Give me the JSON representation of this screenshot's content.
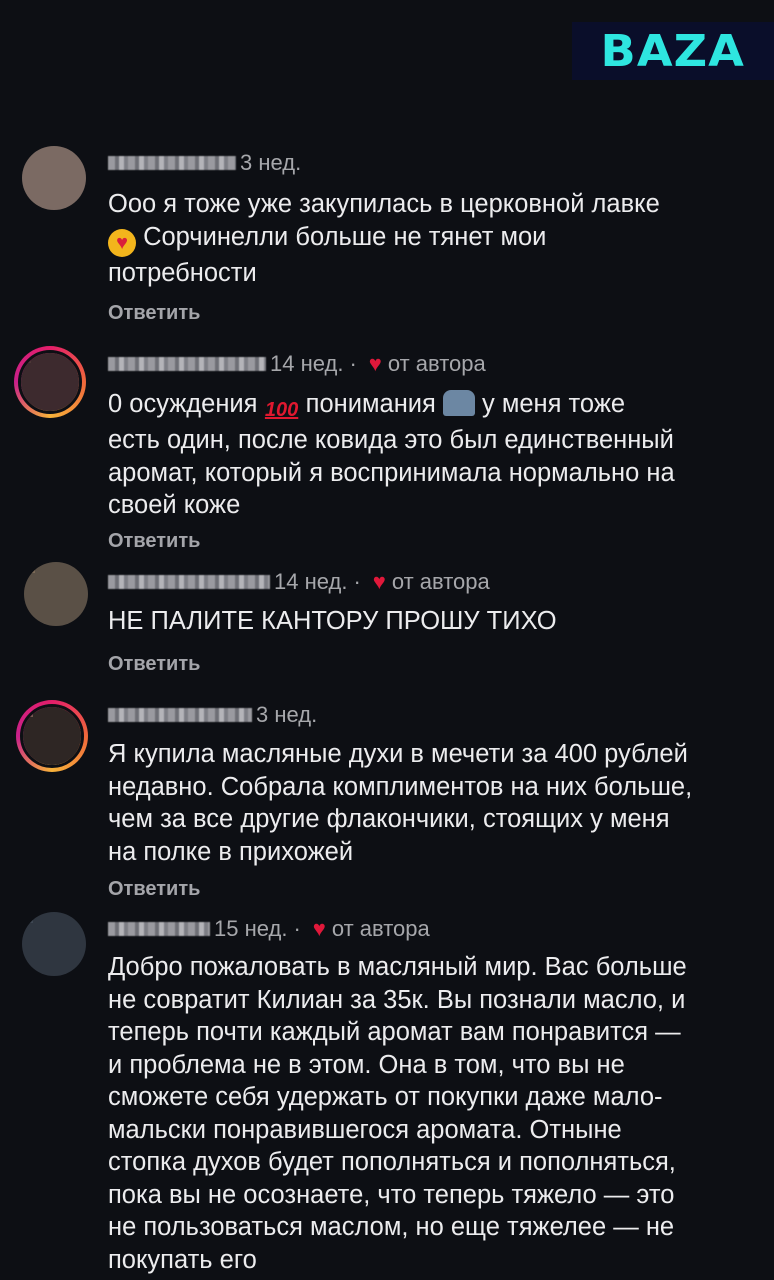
{
  "logo": {
    "text": "BAZA",
    "color": "#2ee6e0",
    "background": "#0a0e2a"
  },
  "reply_label": "Ответить",
  "comments": [
    {
      "time": "3 нед.",
      "author_badge": false,
      "lines": [
        "Ооо я тоже уже закупилась в церковной лавке",
        " Сорчинелли больше не тянет мои",
        "потребности"
      ],
      "emoji": "heart-eyes-icon"
    },
    {
      "time": "14 нед.",
      "author_badge": true,
      "author_text": "от автора",
      "lines": [
        "0 осуждения ",
        " понимания ",
        " у меня тоже",
        "есть один, после ковида это был единственный",
        "аромат, который я воспринимала нормально на",
        "своей коже"
      ]
    },
    {
      "time": "14 нед.",
      "author_badge": true,
      "author_text": "от автора",
      "lines": [
        "НЕ ПАЛИТЕ КАНТОРУ ПРОШУ ТИХО"
      ]
    },
    {
      "time": "3 нед.",
      "author_badge": false,
      "lines": [
        "Я купила масляные духи в мечети за 400 рублей",
        "недавно. Собрала комплиментов на них больше,",
        "чем за все другие флакончики, стоящих у меня",
        "на полке в прихожей"
      ]
    },
    {
      "time": "15 нед.",
      "author_badge": true,
      "author_text": "от автора",
      "lines": [
        "Добро пожаловать в масляный мир. Вас больше",
        "не совратит Килиан за 35к. Вы познали масло, и",
        "теперь почти каждый аромат вам понравится —",
        "и проблема не в этом. Она в том, что вы не",
        "сможете себя удержать от покупки даже мало-",
        "мальски понравившегося аромата. Отныне",
        "стопка духов будет пополняться и пополняться,",
        "пока вы не осознаете, что теперь тяжело — это",
        "не пользоваться маслом, но еще тяжелее — не",
        "покупать его"
      ]
    }
  ],
  "emoji_icons": {
    "hundred": "100-icon",
    "people": "people-icon",
    "heart_eyes": "heart-eyes-icon"
  },
  "colors": {
    "background": "#0d0f14",
    "heart": "#e0183a",
    "ring": "#e31e6a"
  }
}
